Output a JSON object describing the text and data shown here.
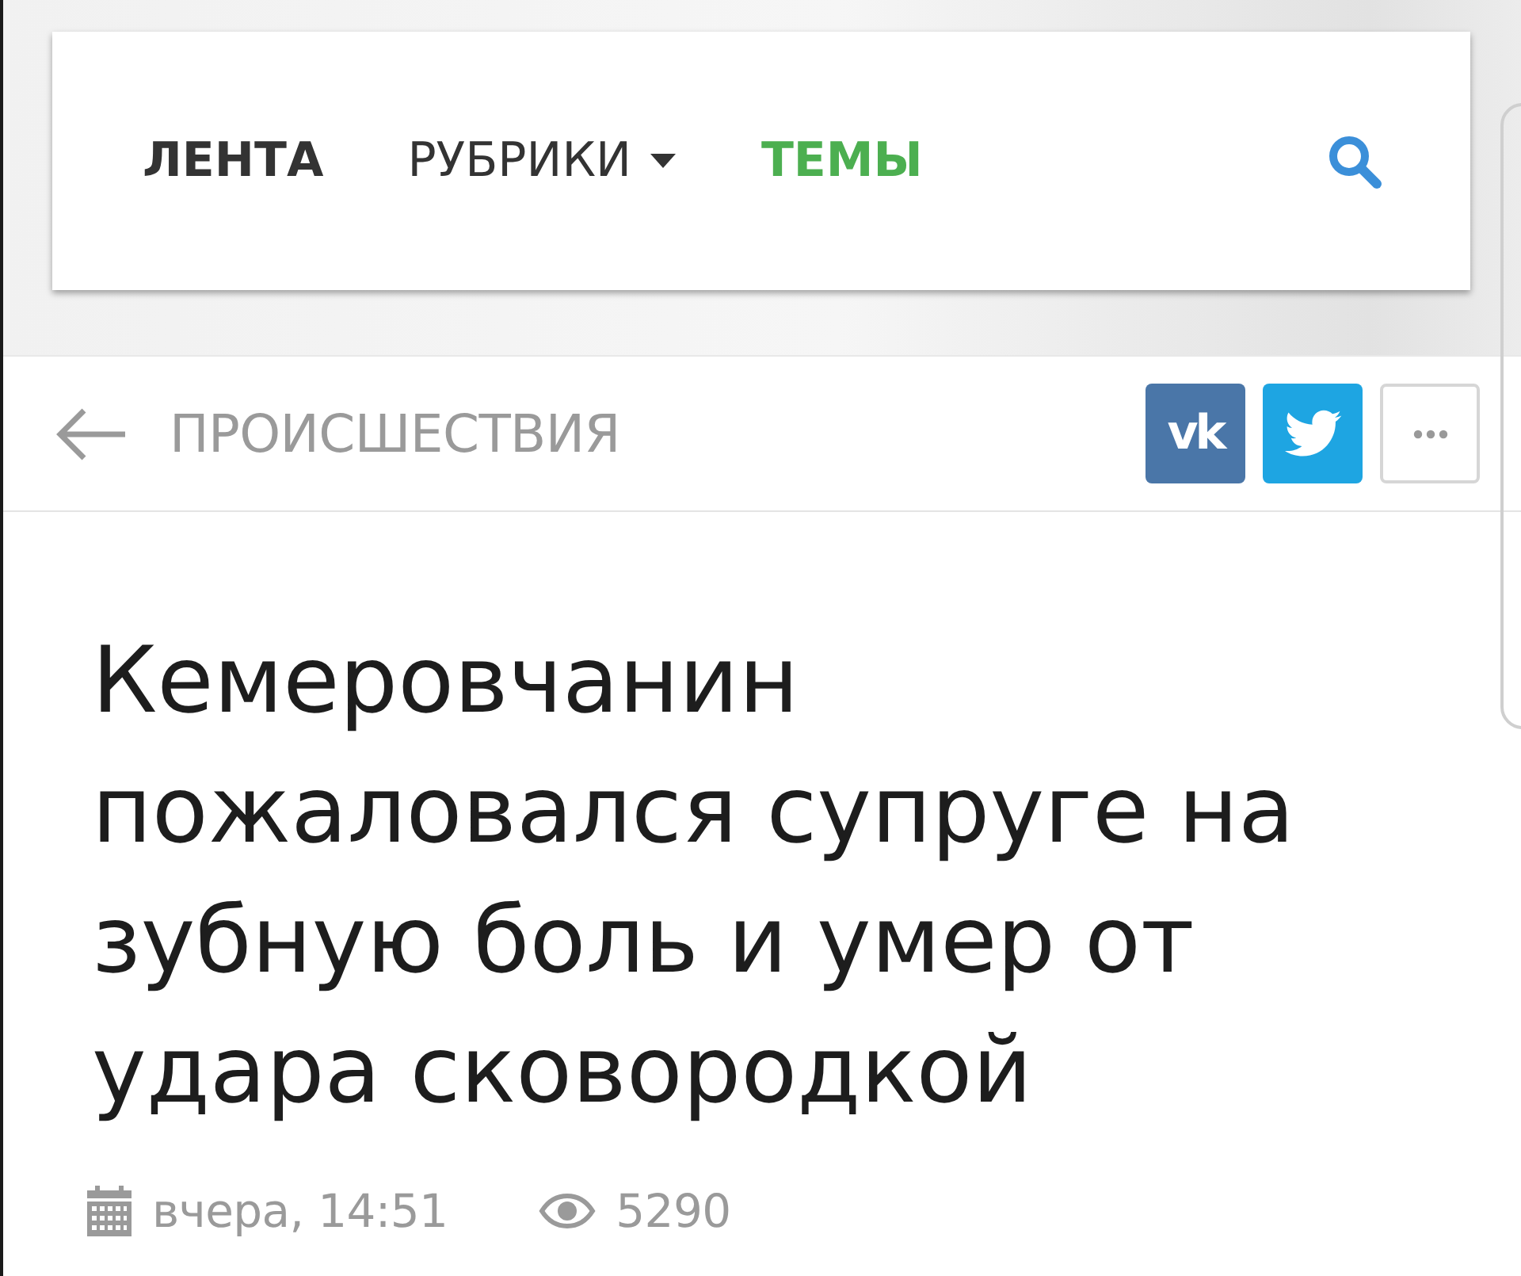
{
  "header": {
    "nav": [
      {
        "label": "ЛЕНТА",
        "kind": "link",
        "color": "#333333"
      },
      {
        "label": "РУБРИКИ",
        "kind": "dropdown",
        "color": "#333333"
      },
      {
        "label": "ТЕМЫ",
        "kind": "link",
        "color": "#4caf50"
      }
    ]
  },
  "section": {
    "label": "ПРОИСШЕСТВИЯ",
    "share": [
      {
        "kind": "vk",
        "label": "vk"
      },
      {
        "kind": "twitter"
      },
      {
        "kind": "more"
      }
    ]
  },
  "article": {
    "title": "Кемеровчанин пожаловался супруге на зубную боль и умер от удара сковородкой",
    "date": "вчера, 14:51",
    "views": "5290"
  }
}
